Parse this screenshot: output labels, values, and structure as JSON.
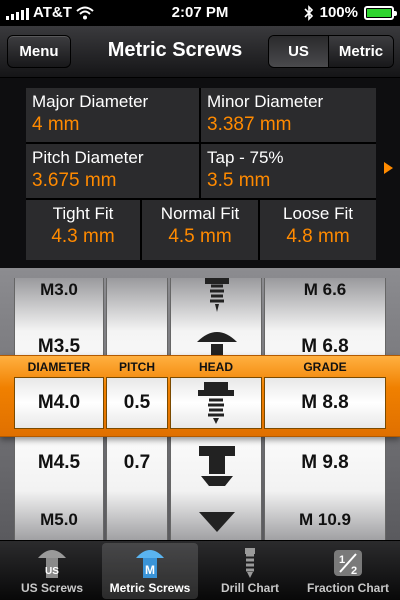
{
  "status": {
    "carrier": "AT&T",
    "time": "2:07 PM",
    "battery": "100%"
  },
  "nav": {
    "menu_label": "Menu",
    "title": "Metric Screws",
    "seg_us": "US",
    "seg_metric": "Metric"
  },
  "info": {
    "major_label": "Major Diameter",
    "major_value": "4 mm",
    "minor_label": "Minor Diameter",
    "minor_value": "3.387 mm",
    "pitch_label": "Pitch Diameter",
    "pitch_value": "3.675 mm",
    "tap_label": "Tap - 75%",
    "tap_value": "3.5 mm",
    "tight_label": "Tight Fit",
    "tight_value": "4.3 mm",
    "normal_label": "Normal Fit",
    "normal_value": "4.5 mm",
    "loose_label": "Loose Fit",
    "loose_value": "4.8 mm"
  },
  "picker": {
    "headers": {
      "diameter": "DIAMETER",
      "pitch": "PITCH",
      "head": "HEAD",
      "grade": "GRADE"
    },
    "diameter": {
      "r0": "M3.0",
      "r1": "M3.5",
      "sel": "M4.0",
      "r3": "M4.5",
      "r4": "M5.0"
    },
    "pitch": {
      "sel": "0.5",
      "r3": "0.7"
    },
    "grade": {
      "r0": "M 6.6",
      "r1": "M 6.8",
      "sel": "M 8.8",
      "r3": "M 9.8",
      "r4": "M 10.9"
    }
  },
  "tabs": {
    "us": "US Screws",
    "metric": "Metric Screws",
    "drill": "Drill Chart",
    "fraction": "Fraction Chart"
  },
  "colors": {
    "accent": "#ff8a00",
    "active_icon": "#5ab4f0"
  }
}
